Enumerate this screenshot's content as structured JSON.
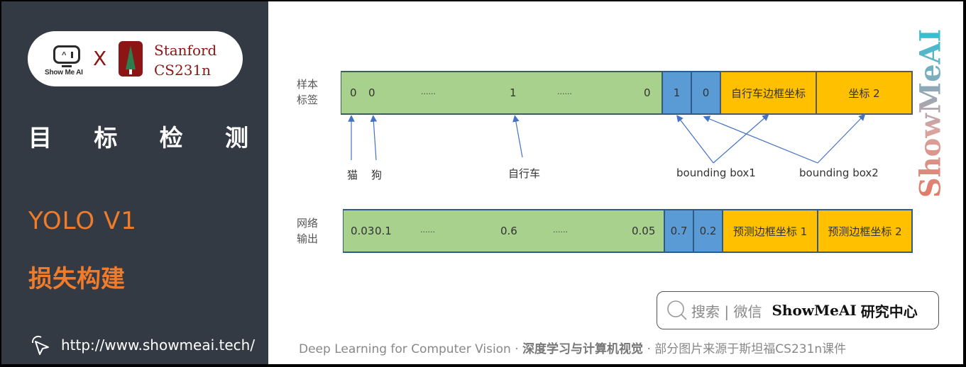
{
  "sidebar": {
    "logo_showmeai": "Show Me AI",
    "logo_x": "X",
    "stanford_line1": "Stanford",
    "stanford_line2": "CS231n",
    "topic_chars": [
      "目",
      "标",
      "检",
      "测"
    ],
    "section_title": "YOLO V1",
    "section_subtitle": "损失构建",
    "site_url": "http://www.showmeai.tech/",
    "site_icon": "cursor-click-icon"
  },
  "diagram": {
    "label_row": {
      "label_line1": "样本",
      "label_line2": "标签",
      "green_values": [
        "0",
        "0",
        "......",
        "1",
        "......",
        "0"
      ],
      "blue_values": [
        "1",
        "0"
      ],
      "yellow_values": [
        "自行车边框坐标",
        "坐标 2"
      ]
    },
    "arrow_labels": {
      "cat": "猫",
      "dog": "狗",
      "bicycle": "自行车",
      "bbox1": "bounding box1",
      "bbox2": "bounding box2"
    },
    "output_row": {
      "label_line1": "网络",
      "label_line2": "输出",
      "green_values": [
        "0.03",
        "0.1",
        "......",
        "0.6",
        "......",
        "0.05"
      ],
      "blue_values": [
        "0.7",
        "0.2"
      ],
      "yellow_values": [
        "预测边框坐标 1",
        "预测边框坐标 2"
      ]
    },
    "colors": {
      "green": "#a9d18e",
      "blue": "#5b9bd5",
      "yellow": "#ffc000",
      "arrow": "#4472c4"
    }
  },
  "watermark": "ShowMeAI",
  "search": {
    "icon": "search-icon",
    "hint": "搜索 | 微信",
    "brand": "ShowMeAI",
    "brand_suffix": "研究中心"
  },
  "footer": {
    "part1": "Deep Learning for Computer Vision",
    "sep": " · ",
    "part2": "深度学习与计算机视觉",
    "part3": "部分图片来源于斯坦福CS231n课件"
  }
}
